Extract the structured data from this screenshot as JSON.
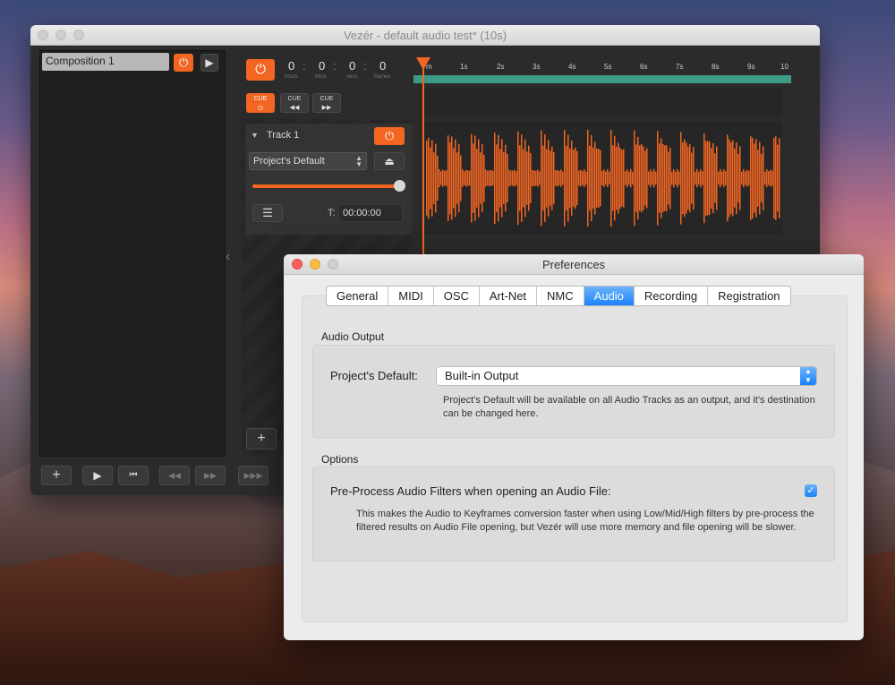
{
  "main_window": {
    "title": "Vezér - default audio test* (10s)",
    "composition": "Composition 1",
    "timecode": {
      "hours": "0",
      "mins": "0",
      "secs": "0",
      "frames": "0",
      "labels": {
        "hours": "hours",
        "mins": "mins",
        "secs": "secs",
        "frames": "frames"
      }
    },
    "cue_labels": [
      "CUE",
      "CUE",
      "CUE"
    ],
    "ruler_ticks": [
      "m",
      "1s",
      "2s",
      "3s",
      "4s",
      "5s",
      "6s",
      "7s",
      "8s",
      "9s",
      "10"
    ],
    "track": {
      "name": "Track 1",
      "output": "Project's Default",
      "volume": 1.0,
      "time_label": "T:",
      "time_value": "00:00:00"
    },
    "colors": {
      "accent": "#f26522",
      "ruler": "#3c9a86"
    },
    "icons": {
      "power": "power-icon",
      "play": "play-icon",
      "eject": "eject-icon",
      "menu": "menu-icon",
      "add": "plus-icon",
      "rewind": "rewind-icon",
      "forward": "fast-forward-icon"
    }
  },
  "preferences": {
    "title": "Preferences",
    "tabs": [
      "General",
      "MIDI",
      "OSC",
      "Art-Net",
      "NMC",
      "Audio",
      "Recording",
      "Registration"
    ],
    "active_tab": "Audio",
    "audio_output": {
      "section_label": "Audio Output",
      "field_label": "Project's Default:",
      "selected_value": "Built-in Output",
      "help_text": "Project's Default will be available on all Audio Tracks as an output, and it's destination can be changed here."
    },
    "options": {
      "section_label": "Options",
      "checkbox_label": "Pre-Process Audio Filters when opening an Audio File:",
      "checked": true,
      "help_text": "This makes the Audio to Keyframes conversion faster when using Low/Mid/High filters by pre-process the filtered results on Audio File opening, but Vezér will use more memory and file opening will be slower."
    },
    "colors": {
      "accent": "#1a82fb"
    }
  }
}
